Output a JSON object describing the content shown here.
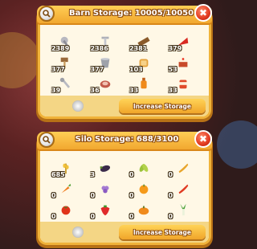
{
  "barn": {
    "title": "Barn Storage: 10005/10050",
    "button_label": "Increase Storage",
    "items": [
      {
        "icon": "bolt-icon",
        "count": "2389"
      },
      {
        "icon": "nail-icon",
        "count": "2386"
      },
      {
        "icon": "plank-icon",
        "count": "2381"
      },
      {
        "icon": "tomato-slice-icon",
        "count": "379"
      },
      {
        "icon": "mallet-icon",
        "count": "377"
      },
      {
        "icon": "bucket-icon",
        "count": "377"
      },
      {
        "icon": "toast-icon",
        "count": "103"
      },
      {
        "icon": "cake-icon",
        "count": "53"
      },
      {
        "icon": "wrench-icon",
        "count": "39"
      },
      {
        "icon": "steak-icon",
        "count": "36"
      },
      {
        "icon": "juice-bottle-icon",
        "count": "33"
      },
      {
        "icon": "soup-jar-icon",
        "count": "33"
      }
    ]
  },
  "silo": {
    "title": "Silo Storage: 688/3100",
    "button_label": "Increase Storage",
    "items": [
      {
        "icon": "wheat-icon",
        "count": "685"
      },
      {
        "icon": "eggplant-icon",
        "count": "3"
      },
      {
        "icon": "green-beans-icon",
        "count": "0"
      },
      {
        "icon": "chili-pepper-icon",
        "count": "0"
      },
      {
        "icon": "carrot-icon",
        "count": "0"
      },
      {
        "icon": "grape-icon",
        "count": "0"
      },
      {
        "icon": "orange-icon",
        "count": "0"
      },
      {
        "icon": "red-pepper-icon",
        "count": "0"
      },
      {
        "icon": "tomato-icon",
        "count": "0"
      },
      {
        "icon": "strawberry-icon",
        "count": "0"
      },
      {
        "icon": "pumpkin-icon",
        "count": "0"
      },
      {
        "icon": "leek-icon",
        "count": "0"
      }
    ]
  }
}
